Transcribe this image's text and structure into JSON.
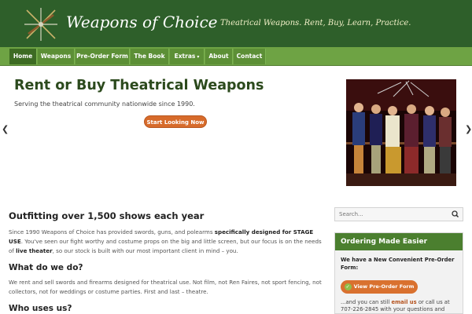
{
  "header": {
    "site_title": "Weapons of Choice",
    "tagline": "Theatrical Weapons.  Rent, Buy, Learn, Practice.",
    "brand_color": "#2e5f2a"
  },
  "nav": {
    "items": [
      {
        "label": "Home",
        "active": true
      },
      {
        "label": "Weapons"
      },
      {
        "label": "Pre-Order Form"
      },
      {
        "label": "The Book"
      },
      {
        "label": "Extras",
        "has_dropdown": true
      },
      {
        "label": "About"
      },
      {
        "label": "Contact"
      }
    ],
    "nav_color": "#6ea344"
  },
  "hero": {
    "title": "Rent or Buy Theatrical Weapons",
    "subtitle": "Serving the theatrical community nationwide since 1990.",
    "button_label": "Start Looking Now",
    "prev_icon": "chevron-left-icon",
    "next_icon": "chevron-right-icon",
    "photo_icon": "stage-musketeers-photo"
  },
  "main": {
    "heading": "Outfitting over 1,500 shows each year",
    "intro_1": "Since 1990 Weapons of Choice has provided swords, guns, and polearms ",
    "intro_bold": "specifically designed for STAGE USE",
    "intro_2": ". You've seen our fight worthy and costume props on the big and little screen, but our focus is on the needs of ",
    "intro_bold2": "live theater",
    "intro_3": ", so our stock is built with our most important client in mind – you.",
    "what_heading": "What do we do?",
    "what_text": "We rent and sell swords and firearms designed for theatrical use. Not film, not Ren Faires, not sport fencing, not collectors, not for weddings or costume parties. First and last – theatre.",
    "who_heading": "Who uses us?"
  },
  "sidebar": {
    "search_placeholder": "Search...",
    "search_icon": "search-icon",
    "widget_title": "Ordering Made Easier",
    "widget_intro": "We have a New Convenient Pre-Order Form:",
    "widget_button": "View Pre-Order Form",
    "widget_text_1": "...and you can still ",
    "widget_link": "email us",
    "widget_text_2": " or call us at 707-226-2845 with your questions and"
  }
}
